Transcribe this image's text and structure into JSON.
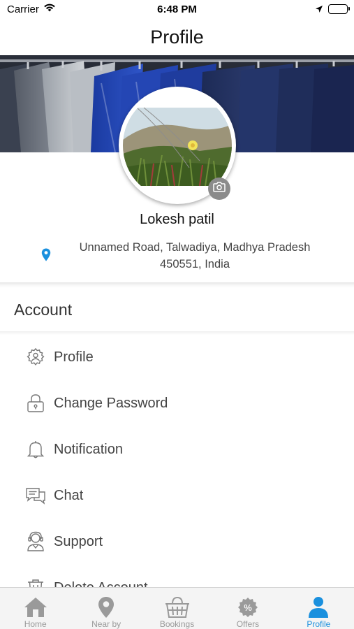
{
  "status_bar": {
    "carrier": "Carrier",
    "time": "6:48 PM"
  },
  "header": {
    "title": "Profile"
  },
  "profile": {
    "name": "Lokesh patil",
    "address_line1": "Unnamed Road, Talwadiya, Madhya Pradesh",
    "address_line2": "450551, India"
  },
  "account_section": {
    "title": "Account",
    "items": [
      {
        "label": "Profile",
        "icon": "profile-gear-icon"
      },
      {
        "label": "Change Password",
        "icon": "lock-icon"
      },
      {
        "label": "Notification",
        "icon": "bell-icon"
      },
      {
        "label": "Chat",
        "icon": "chat-icon"
      },
      {
        "label": "Support",
        "icon": "support-agent-icon"
      },
      {
        "label": "Delete Account",
        "icon": "trash-icon"
      }
    ]
  },
  "tab_bar": {
    "tabs": [
      {
        "label": "Home",
        "icon": "home-icon",
        "active": false
      },
      {
        "label": "Near by",
        "icon": "map-pin-icon",
        "active": false
      },
      {
        "label": "Bookings",
        "icon": "basket-icon",
        "active": false
      },
      {
        "label": "Offers",
        "icon": "percent-badge-icon",
        "active": false
      },
      {
        "label": "Profile",
        "icon": "user-icon",
        "active": true
      }
    ]
  },
  "colors": {
    "accent": "#1a90de",
    "inactive": "#999999",
    "pin": "#1a90de"
  }
}
